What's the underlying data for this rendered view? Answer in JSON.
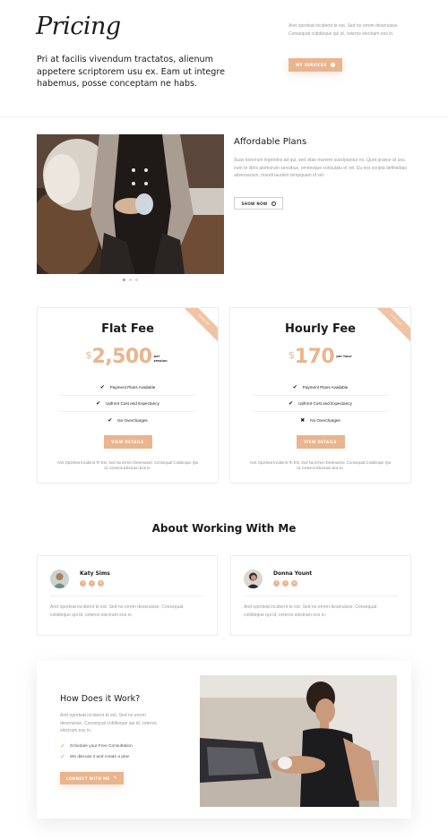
{
  "hero": {
    "title": "Pricing",
    "subtitle": "Pri at facilis vivendum tractatos, alienum appetere scriptorem usu ex. Eam ut integre habemus, posse conceptam ne habs.",
    "description": "Aret oporteat incidernt te est. Sed no errem deseruisse. Consequat cotidieque qui id, ceteros electram eos in.",
    "button_label": "MY SERVICES"
  },
  "affordable": {
    "title": "Affordable Plans",
    "description": "Suas bonorum legendos ad qui, sed vitae munere suscipiantur no. Quot graece at usu, eum te libris atomorum sensibus, omnesque consulatu et vel. Eu eos scripta definiebas adversarium, mundi laudem tempquam id vel.",
    "button_label": "SHOW NOW"
  },
  "plans": [
    {
      "title": "Flat Fee",
      "ribbon": "POPULAR",
      "currency": "$",
      "amount": "2,500",
      "period": "per session",
      "features": [
        {
          "text": "Payment Plans Available",
          "included": true
        },
        {
          "text": "Upfront Cost and Expectancy",
          "included": true
        },
        {
          "text": "No Overcharges",
          "included": true
        }
      ],
      "button_label": "VIEW DETAILS",
      "fine_print": "Aret Oporteat Incidernt Te Est. Sed No Errem Deseruisse. Consequat Cotidieque Qui Id, Ceteros Electram Eos In."
    },
    {
      "title": "Hourly Fee",
      "ribbon": "POPULAR",
      "currency": "$",
      "amount": "170",
      "period": "per hour",
      "features": [
        {
          "text": "Payment Plans Available",
          "included": true
        },
        {
          "text": "Upfront Cost and Expectancy",
          "included": true
        },
        {
          "text": "No Overcharges",
          "included": false
        }
      ],
      "button_label": "VIEW DETAILS",
      "fine_print": "Aret Oporteat Incidernt Te Est. Sed No Errem Deseruisse. Consequat Cotidieque Qui Id, Ceteros Electram Eos In."
    }
  ],
  "about": {
    "title": "About Working With Me",
    "testimonials": [
      {
        "name": "Katy Sims",
        "quote": "Aret oporteat incidernt te est. Sed no errem deseruisse. Consequat cotidieque qui id, ceteros electram eos in."
      },
      {
        "name": "Donna Yount",
        "quote": "Aret oporteat incidernt te est. Sed no errem deseruisse. Consequat cotidieque qui id, ceteros electram eos in."
      }
    ]
  },
  "how": {
    "title": "How Does it Work?",
    "description": "Aret oporteat incidernt te est. Sed no errem deseruisse. Consequat cotidieque qui id, ceteros electram eos in.",
    "steps": [
      "Schedule your Free Consultation",
      "We discuss it and create a plan"
    ],
    "button_label": "CONNECT WITH ME"
  },
  "colors": {
    "accent": "#e9b58e",
    "ribbon": "#efc3a3",
    "text": "#1a1a1a"
  }
}
